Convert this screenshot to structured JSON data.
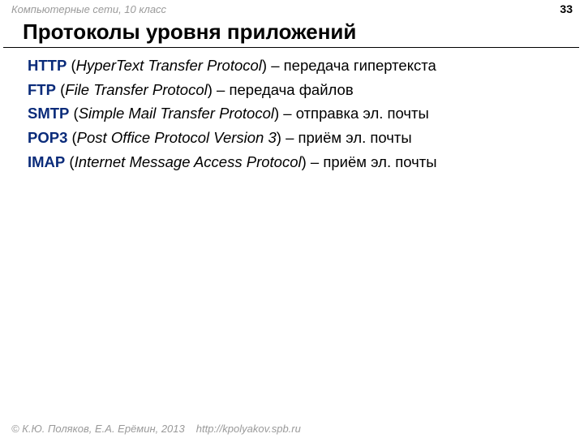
{
  "header": {
    "subject": "Компьютерные сети, 10 класс",
    "page": "33"
  },
  "title": "Протоколы уровня приложений",
  "protocols": [
    {
      "name": "HTTP",
      "full": "HyperText Transfer Protocol",
      "desc": "передача гипертекста"
    },
    {
      "name": "FTP",
      "full": "File Transfer Protocol",
      "desc": "передача файлов"
    },
    {
      "name": "SMTP",
      "full": "Simple Mail Transfer Protocol",
      "desc": "отправка эл. почты"
    },
    {
      "name": "POP3",
      "full": "Post Office Protocol Version 3",
      "desc": "приём эл. почты"
    },
    {
      "name": "IMAP",
      "full": "Internet Message Access Protocol",
      "desc": "приём эл. почты"
    }
  ],
  "footer": {
    "copyright": "© К.Ю. Поляков, Е.А. Ерёмин, 2013",
    "url": "http://kpolyakov.spb.ru"
  }
}
